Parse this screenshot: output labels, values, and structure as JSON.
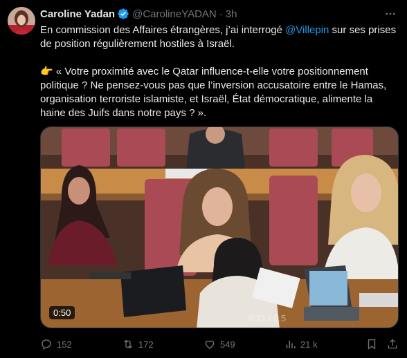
{
  "author": {
    "name": "Caroline Yadan",
    "handle": "@CarolineYADAN",
    "separator": "·",
    "time": "3h",
    "verified": true
  },
  "tweet": {
    "line1_prefix": "En commission des Affaires étrangères, j’ai interrogé ",
    "mention": "@Villepin",
    "line1_suffix": " sur ses prises de position régulièrement hostiles à Israël.",
    "quote_emoji": "👉",
    "quote": " « Votre proximité avec le Qatar influence-t-elle votre positionnement politique ? Ne pensez-vous pas que l’inversion accusatoire entre le Hamas, organisation terroriste islamiste, et Israël, État démocratique, alimente la haine des Juifs dans notre pays ? »."
  },
  "media": {
    "duration": "0:50",
    "watermark": "0:21 / 0:5"
  },
  "actions": {
    "replies": "152",
    "retweets": "172",
    "likes": "549",
    "views": "21 k"
  },
  "colors": {
    "background": "#000000",
    "text": "#e7e9ea",
    "muted": "#71767b",
    "accent": "#1d9bf0"
  }
}
